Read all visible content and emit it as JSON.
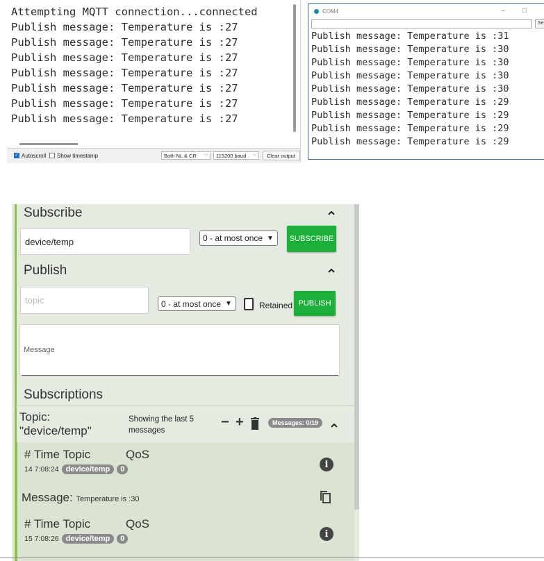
{
  "serial_monitor_1": {
    "lines": [
      "Attempting MQTT connection...connected",
      "Publish message: Temperature is :27",
      "Publish message: Temperature is :27",
      "Publish message: Temperature is :27",
      "Publish message: Temperature is :27",
      "Publish message: Temperature is :27",
      "Publish message: Temperature is :27",
      "Publish message: Temperature is :27"
    ],
    "toolbar": {
      "autoscroll_label": "Autoscroll",
      "autoscroll_checked": true,
      "timestamp_label": "Show timestamp",
      "timestamp_checked": false,
      "line_ending": "Both NL & CR",
      "baud": "115200 baud",
      "clear_label": "Clear output"
    }
  },
  "serial_monitor_2": {
    "title": "COM4",
    "minimize_icon": "–",
    "maximize_icon": "□",
    "send_label": "Se",
    "lines": [
      "Publish message: Temperature is :31",
      "Publish message: Temperature is :30",
      "Publish message: Temperature is :30",
      "Publish message: Temperature is :30",
      "Publish message: Temperature is :30",
      "Publish message: Temperature is :29",
      "Publish message: Temperature is :29",
      "Publish message: Temperature is :29",
      "Publish message: Temperature is :29"
    ]
  },
  "mqtt_client": {
    "accent_color": "#1cb03a",
    "subscribe": {
      "title": "Subscribe",
      "topic_value": "device/temp",
      "qos": "0 - at most once",
      "button_label": "SUBSCRIBE"
    },
    "publish": {
      "title": "Publish",
      "topic_placeholder": "topic",
      "qos": "0 - at most once",
      "retained_label": "Retained",
      "button_label": "PUBLISH",
      "message_placeholder": "Message"
    },
    "subscriptions": {
      "title": "Subscriptions",
      "topic_label": "Topic:",
      "topic_name": "\"device/temp\"",
      "showing_text": "Showing the last 5 messages",
      "count_badge": "Messages: 0/19"
    },
    "messages": [
      {
        "header_left": "# Time Topic",
        "header_qos": "QoS",
        "time": "14 7:08:24",
        "topic": "device/temp",
        "qos": "0",
        "message_label": "Message:",
        "payload": "Temperature is :30"
      },
      {
        "header_left": "# Time Topic",
        "header_qos": "QoS",
        "time": "15 7:08:26",
        "topic": "device/temp",
        "qos": "0"
      }
    ]
  }
}
